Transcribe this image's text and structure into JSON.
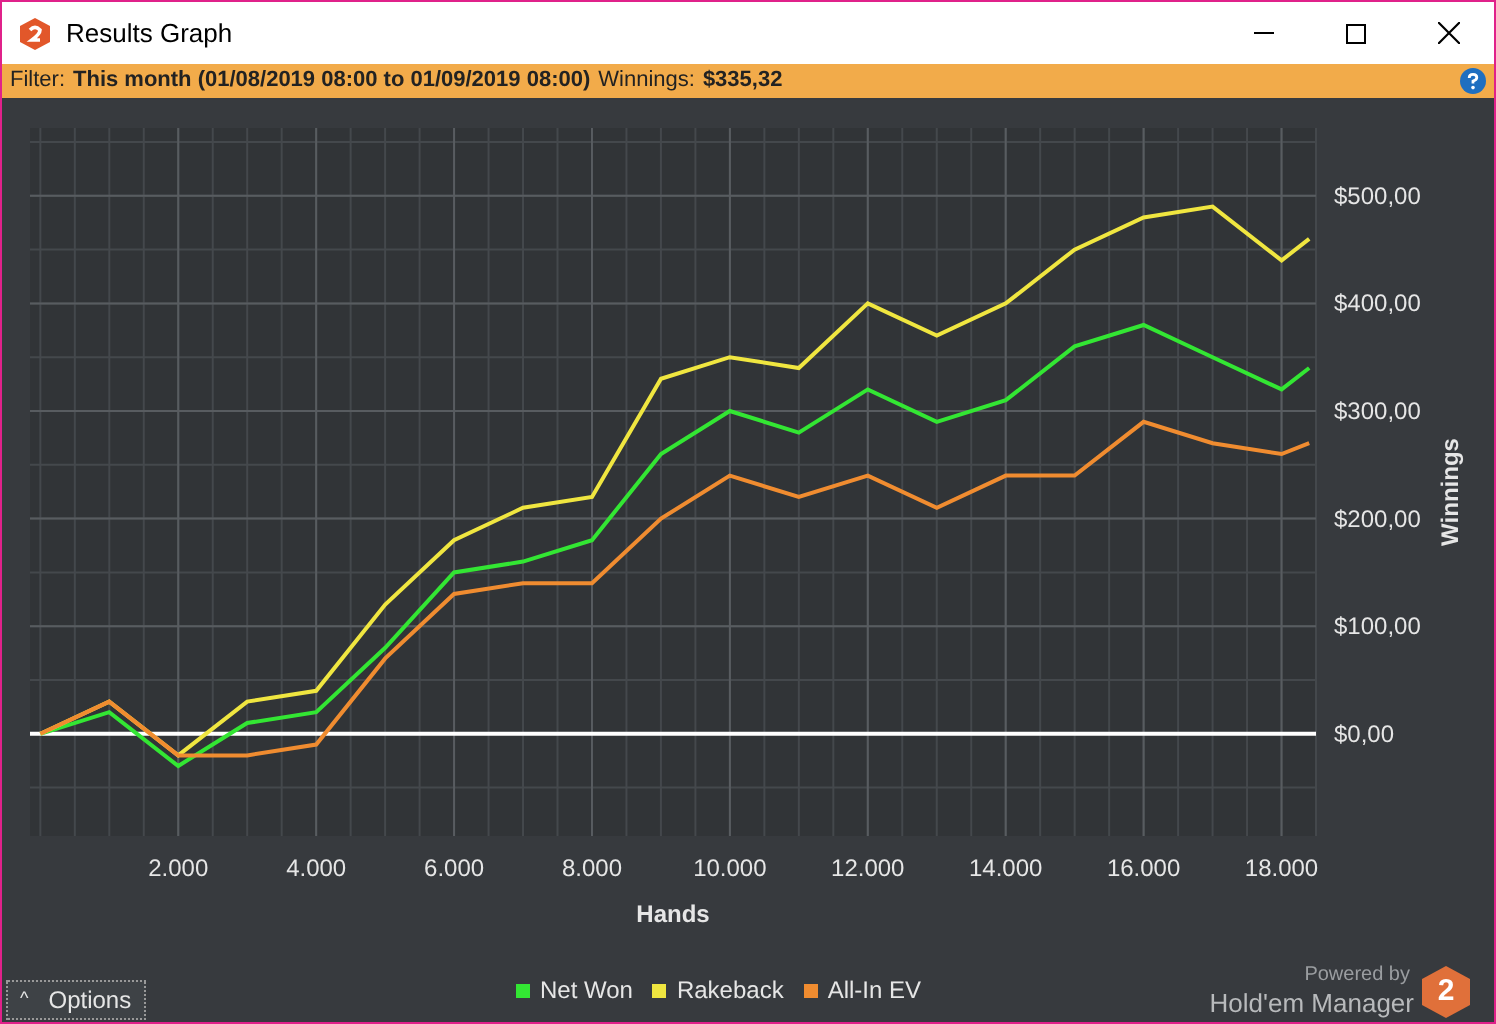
{
  "window": {
    "title": "Results Graph"
  },
  "filter_bar": {
    "label": "Filter:",
    "filter": "This month (01/08/2019 08:00 to 01/09/2019 08:00)",
    "winnings_label": "Winnings:",
    "winnings": "$335,32"
  },
  "chart": {
    "chart_data": {
      "type": "line",
      "xlabel": "Hands",
      "ylabel": "Winnings",
      "x": [
        0,
        1000,
        2000,
        3000,
        4000,
        5000,
        6000,
        7000,
        8000,
        9000,
        10000,
        11000,
        12000,
        13000,
        14000,
        15000,
        16000,
        17000,
        18000,
        18400
      ],
      "series": [
        {
          "name": "Net Won",
          "color": "#33e633",
          "values": [
            0,
            20,
            -30,
            10,
            20,
            80,
            150,
            160,
            180,
            260,
            300,
            280,
            320,
            290,
            310,
            360,
            380,
            350,
            320,
            340
          ]
        },
        {
          "name": "Rakeback",
          "color": "#f0e640",
          "values": [
            0,
            30,
            -20,
            30,
            40,
            120,
            180,
            210,
            220,
            330,
            350,
            340,
            400,
            370,
            400,
            450,
            480,
            490,
            440,
            460
          ]
        },
        {
          "name": "All-In EV",
          "color": "#f08c30",
          "values": [
            0,
            30,
            -20,
            -20,
            -10,
            70,
            130,
            140,
            140,
            200,
            240,
            220,
            240,
            210,
            240,
            240,
            290,
            270,
            260,
            270
          ]
        }
      ],
      "grid": true,
      "xlim": [
        -150,
        18500
      ],
      "ylim": [
        -95,
        563
      ],
      "xticks": [
        {
          "value": 2000,
          "label": "2.000"
        },
        {
          "value": 4000,
          "label": "4.000"
        },
        {
          "value": 6000,
          "label": "6.000"
        },
        {
          "value": 8000,
          "label": "8.000"
        },
        {
          "value": 10000,
          "label": "10.000"
        },
        {
          "value": 12000,
          "label": "12.000"
        },
        {
          "value": 14000,
          "label": "14.000"
        },
        {
          "value": 16000,
          "label": "16.000"
        },
        {
          "value": 18000,
          "label": "18.000"
        }
      ],
      "yticks": [
        {
          "value": 0,
          "label": "$0,00"
        },
        {
          "value": 100,
          "label": "$100,00"
        },
        {
          "value": 200,
          "label": "$200,00"
        },
        {
          "value": 300,
          "label": "$300,00"
        },
        {
          "value": 400,
          "label": "$400,00"
        },
        {
          "value": 500,
          "label": "$500,00"
        }
      ]
    }
  },
  "footer": {
    "options_button": "Options",
    "options_caret": "^",
    "powered_by": "Powered by",
    "product": "Hold'em Manager",
    "logo_mark": "2"
  }
}
